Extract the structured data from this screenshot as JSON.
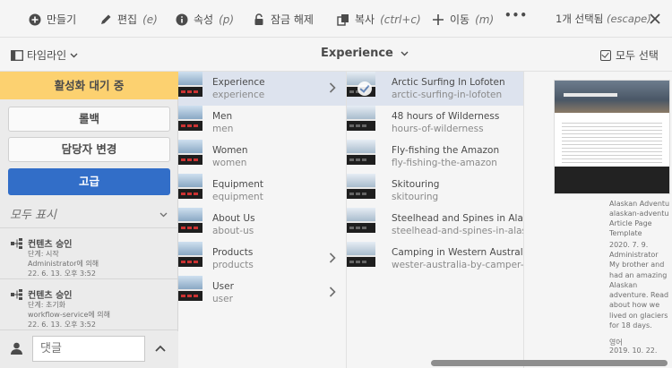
{
  "actionbar": {
    "create": "만들기",
    "edit": "편집",
    "edit_hint": "(e)",
    "properties": "속성",
    "properties_hint": "(p)",
    "unlock": "잠금 해제",
    "copy": "복사",
    "copy_hint": "(ctrl+c)",
    "move": "이동",
    "move_hint": "(m)",
    "more": "•••",
    "selection_count": "1개 선택됨",
    "escape_hint": "(escape)"
  },
  "subheader": {
    "rail_label": "타임라인",
    "breadcrumb": "Experience",
    "select_all": "모두 선택"
  },
  "timeline": {
    "banner": "활성화 대기 중",
    "rollback": "롤백",
    "change_assignee": "담당자 변경",
    "advanced": "고급",
    "filter": "모두 표시",
    "items": [
      {
        "title": "컨텐츠 승인",
        "step": "단계: 시작",
        "who": "Administrator에 의해",
        "when": "22. 6. 13. 오후 3:52"
      },
      {
        "title": "컨텐츠 승인",
        "step": "단계: 초기화",
        "who": "workflow-service에 의해",
        "when": "22. 6. 13. 오후 3:52"
      }
    ],
    "comment_placeholder": "댓글"
  },
  "column1": [
    {
      "name": "Experience",
      "slug": "experience",
      "selected": true,
      "has_children": true
    },
    {
      "name": "Men",
      "slug": "men",
      "selected": false,
      "has_children": false
    },
    {
      "name": "Women",
      "slug": "women",
      "selected": false,
      "has_children": false
    },
    {
      "name": "Equipment",
      "slug": "equipment",
      "selected": false,
      "has_children": false
    },
    {
      "name": "About Us",
      "slug": "about-us",
      "selected": false,
      "has_children": false
    },
    {
      "name": "Products",
      "slug": "products",
      "selected": false,
      "has_children": true
    },
    {
      "name": "User",
      "slug": "user",
      "selected": false,
      "has_children": true
    }
  ],
  "column2": [
    {
      "name": "Arctic Surfing In Lofoten",
      "slug": "arctic-surfing-in-lofoten",
      "selected": true
    },
    {
      "name": "48 hours of Wilderness",
      "slug": "hours-of-wilderness",
      "selected": false
    },
    {
      "name": "Fly-fishing the Amazon",
      "slug": "fly-fishing-the-amazon",
      "selected": false
    },
    {
      "name": "Skitouring",
      "slug": "skitouring",
      "selected": false
    },
    {
      "name": "Steelhead and Spines in Alaska",
      "slug": "steelhead-and-spines-in-alaska",
      "selected": false
    },
    {
      "name": "Camping in Western Australia",
      "slug": "wester-australia-by-camper-van",
      "selected": false
    }
  ],
  "preview": {
    "meta": [
      {
        "key": "제목",
        "value": "Alaskan Adventu"
      },
      {
        "key": "이름",
        "value": "alaskan-adventu"
      },
      {
        "key": "템플릿",
        "value": "Article Page"
      },
      {
        "key": "",
        "value": "Template"
      },
      {
        "key": "수정 시간",
        "value": "2020. 7. 9."
      },
      {
        "key": "수정한 사람",
        "value": "Administrator"
      },
      {
        "key": "설명",
        "value": "My brother and"
      },
      {
        "key": "",
        "value": "had an amazing"
      },
      {
        "key": "",
        "value": "Alaskan"
      },
      {
        "key": "",
        "value": "adventure. Read"
      },
      {
        "key": "",
        "value": "about how we"
      },
      {
        "key": "",
        "value": "lived on glaciers"
      },
      {
        "key": "",
        "value": "for 18 days."
      },
      {
        "key": "언어",
        "value": "영어"
      },
      {
        "key": "게시됨",
        "value": "2019. 10. 22."
      }
    ]
  }
}
